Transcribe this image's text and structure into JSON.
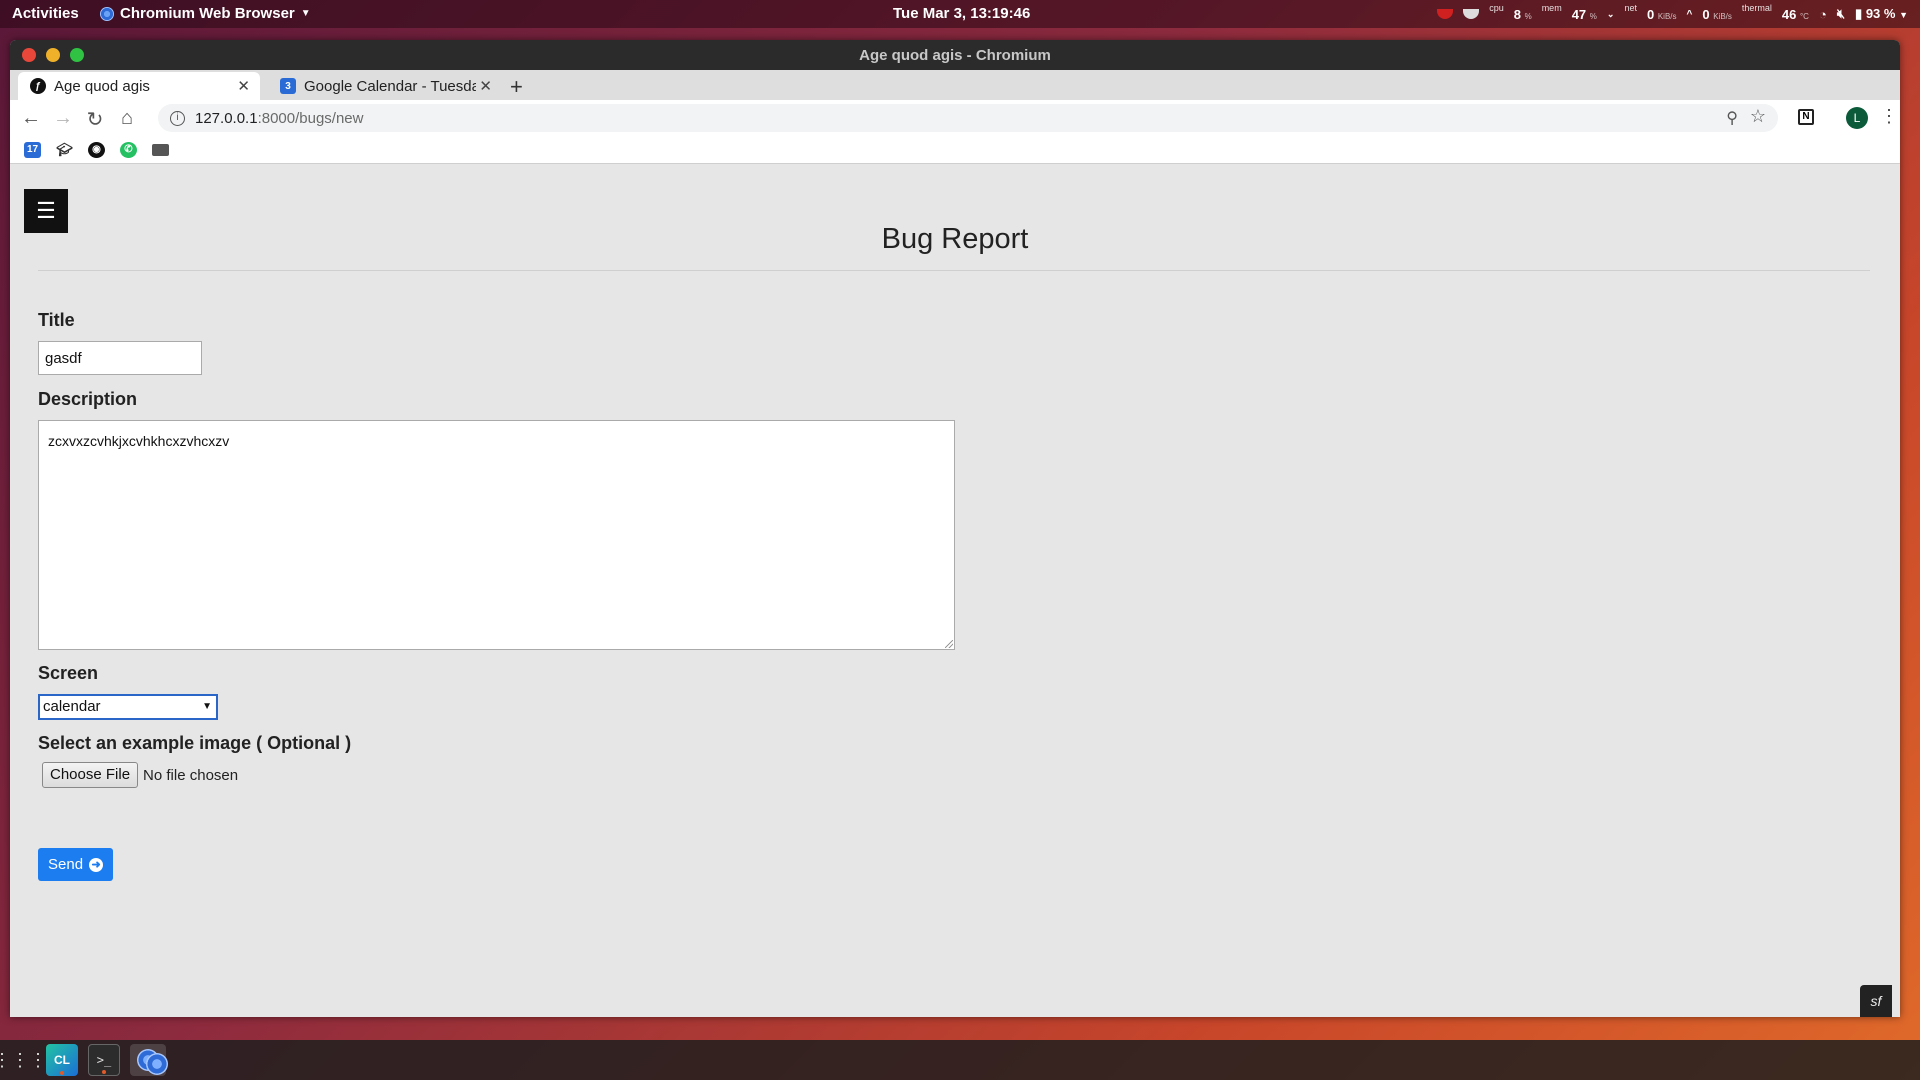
{
  "topbar": {
    "activities": "Activities",
    "app_name": "Chromium Web Browser",
    "clock": "Tue Mar  3, 13:19:46",
    "cpu_label": "cpu",
    "cpu_value": "8",
    "cpu_unit": "%",
    "mem_label": "mem",
    "mem_value": "47",
    "mem_unit": "%",
    "net_label": "net",
    "net_down": "0",
    "net_down_unit": "KiB/s",
    "net_up": "0",
    "net_up_unit": "KiB/s",
    "thermal_label": "thermal",
    "thermal_value": "46",
    "thermal_unit": "°C",
    "battery": "93 %"
  },
  "window": {
    "title": "Age quod agis - Chromium"
  },
  "tabs": [
    {
      "label": "Age quod agis",
      "active": true
    },
    {
      "label": "Google Calendar - Tuesda",
      "active": false
    }
  ],
  "toolbar": {
    "url_host": "127.0.0.1",
    "url_path": ":8000/bugs/new",
    "profile_initial": "L"
  },
  "bookmarks": {
    "calendar_badge": "17"
  },
  "page": {
    "menu_glyph": "☰",
    "title": "Bug Report",
    "title_label": "Title",
    "title_value": "gasdf",
    "description_label": "Description",
    "description_value": "zcxvxzcvhkjxcvhkhcxzvhcxzv",
    "screen_label": "Screen",
    "screen_value": "calendar",
    "image_label": "Select an example image ( Optional )",
    "file_button": "Choose File",
    "file_status": "No file chosen",
    "send_label": "Send"
  },
  "colors": {
    "accent": "#1b7df0",
    "page_bg": "#e6e6e6"
  }
}
